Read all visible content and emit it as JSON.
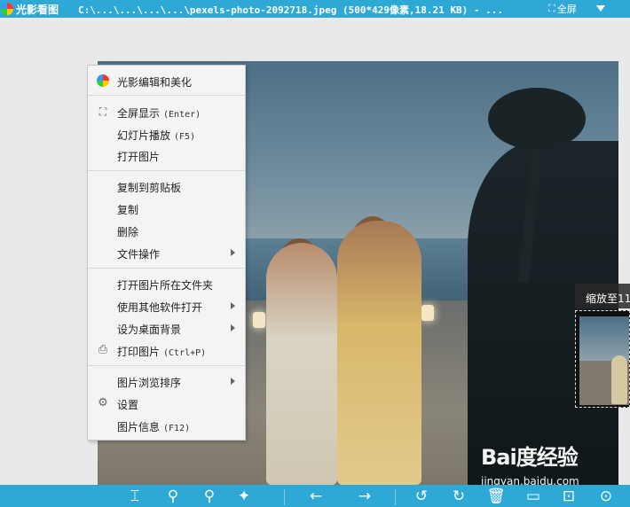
{
  "titlebar": {
    "app_name": "光影看图",
    "title": "C:\\...\\...\\...\\...\\pexels-photo-2092718.jpeg (500*429像素,18.21 KB) - ...",
    "fullscreen_label": "全屏"
  },
  "context_menu": {
    "items": [
      {
        "label": "光影编辑和美化",
        "shortcut": "",
        "icon": "color-wheel-icon",
        "submenu": false
      },
      {
        "label": "全屏显示",
        "shortcut": "(Enter)",
        "icon": "fullscreen-icon",
        "submenu": false
      },
      {
        "label": "幻灯片播放",
        "shortcut": "(F5)",
        "icon": "",
        "submenu": false
      },
      {
        "label": "打开图片",
        "shortcut": "",
        "icon": "",
        "submenu": false
      },
      {
        "label": "复制到剪贴板",
        "shortcut": "",
        "icon": "",
        "submenu": false
      },
      {
        "label": "复制",
        "shortcut": "",
        "icon": "",
        "submenu": false
      },
      {
        "label": "删除",
        "shortcut": "",
        "icon": "",
        "submenu": false
      },
      {
        "label": "文件操作",
        "shortcut": "",
        "icon": "",
        "submenu": true
      },
      {
        "label": "打开图片所在文件夹",
        "shortcut": "",
        "icon": "",
        "submenu": false
      },
      {
        "label": "使用其他软件打开",
        "shortcut": "",
        "icon": "",
        "submenu": true
      },
      {
        "label": "设为桌面背景",
        "shortcut": "",
        "icon": "",
        "submenu": true
      },
      {
        "label": "打印图片",
        "shortcut": "(Ctrl+P)",
        "icon": "printer-icon",
        "submenu": false
      },
      {
        "label": "图片浏览排序",
        "shortcut": "",
        "icon": "",
        "submenu": true
      },
      {
        "label": "设置",
        "shortcut": "",
        "icon": "gear-icon",
        "submenu": false
      },
      {
        "label": "图片信息",
        "shortcut": "(F12)",
        "icon": "",
        "submenu": false
      }
    ]
  },
  "zoom_popup": {
    "text": "缩放至11"
  },
  "toolbar": {
    "buttons": [
      {
        "name": "crop-icon",
        "glyph": "⌶"
      },
      {
        "name": "zoom-in-icon",
        "glyph": "⚲"
      },
      {
        "name": "zoom-out-icon",
        "glyph": "⚲"
      },
      {
        "name": "magic-wand-icon",
        "glyph": "✦"
      },
      {
        "name": "previous-arrow-icon",
        "glyph": "←"
      },
      {
        "name": "next-arrow-icon",
        "glyph": "→"
      },
      {
        "name": "rotate-left-icon",
        "glyph": "↺"
      },
      {
        "name": "rotate-right-icon",
        "glyph": "↻"
      },
      {
        "name": "delete-icon",
        "glyph": "🗑"
      },
      {
        "name": "folder-icon",
        "glyph": "▭"
      },
      {
        "name": "fit-icon",
        "glyph": "⊡"
      },
      {
        "name": "more-icon",
        "glyph": "⊙"
      }
    ]
  },
  "watermark": {
    "logo": "Bai度经验",
    "url": "jingyan.baidu.com"
  },
  "colors": {
    "accent": "#2ea9d6",
    "menu_bg": "#f4f4f4"
  }
}
